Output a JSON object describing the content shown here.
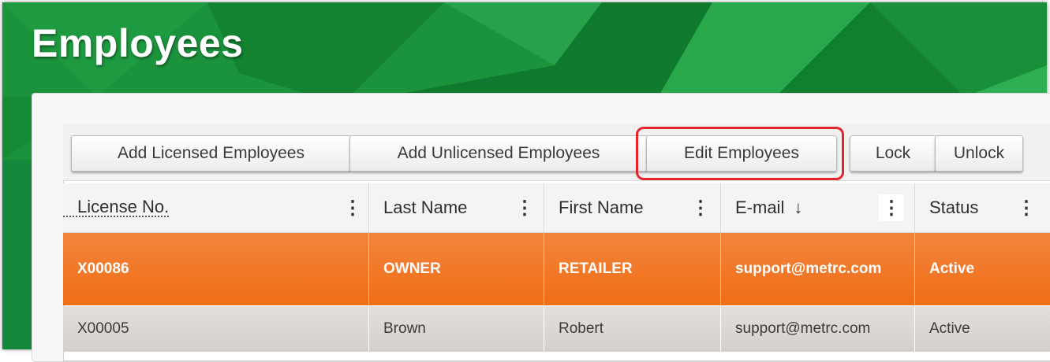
{
  "page": {
    "title": "Employees"
  },
  "toolbar": {
    "add_licensed_label": "Add Licensed Employees",
    "add_unlicensed_label": "Add Unlicensed Employees",
    "edit_label": "Edit Employees",
    "lock_label": "Lock",
    "unlock_label": "Unlock"
  },
  "table": {
    "columns": [
      {
        "label": "License No.",
        "sorted": false
      },
      {
        "label": "Last Name",
        "sorted": false
      },
      {
        "label": "First Name",
        "sorted": false
      },
      {
        "label": "E-mail",
        "sorted": true,
        "sort_direction": "descending"
      },
      {
        "label": "Status",
        "sorted": false
      }
    ],
    "menu_glyph": "⋮",
    "sort_glyph": "↓",
    "rows": [
      {
        "license": "X00086",
        "last": "OWNER",
        "first": "RETAILER",
        "email": "support@metrc.com",
        "status": "Active",
        "selected": true
      },
      {
        "license": "X00005",
        "last": "Brown",
        "first": "Robert",
        "email": "support@metrc.com",
        "status": "Active",
        "selected": false
      }
    ]
  },
  "colors": {
    "header_green": "#19913a",
    "selected_row": "#f06d17",
    "highlight_outline": "#e4262c"
  },
  "icons": [
    "column-menu-icon",
    "sort-descending-icon"
  ]
}
